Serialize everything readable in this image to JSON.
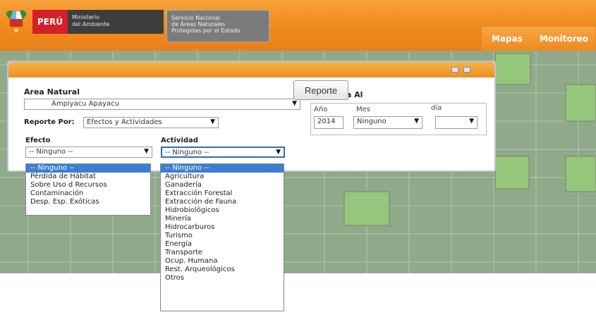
{
  "header": {
    "peru_label": "PERÚ",
    "ministerio_line1": "Ministerio",
    "ministerio_line2": "del Ambiente",
    "sernanp_line1": "Servicio Nacional",
    "sernanp_line2": "de Áreas Naturales",
    "sernanp_line3": "Protegidas por el Estado",
    "nav": [
      "Mapas",
      "Monitoreo"
    ]
  },
  "panel": {
    "area_label": "Area Natural",
    "area_value": "Ampiyacu Apayacu",
    "reporte_por_label": "Reporte Por:",
    "reporte_por_value": "Efectos y Actividades",
    "efecto_label": "Efecto",
    "efecto_value": "-- Ninguno --",
    "actividad_label": "Actividad",
    "actividad_value": "-- Ninguno --",
    "fecha_label": "Fecha Al",
    "anio_label": "Año",
    "mes_label": "Mes",
    "dia_label": "día",
    "anio_value": "2014",
    "mes_value": "Ninguno",
    "dia_value": "",
    "reporte_button": "Reporte"
  },
  "efecto_options": [
    "-- Ninguno --",
    "Pérdida de Hábitat",
    "Sobre Uso d Recursos",
    "Contaminación",
    "Desp. Esp. Exóticas"
  ],
  "actividad_options": [
    "-- Ninguno --",
    "Agricultura",
    "Ganadería",
    "Extracción Forestal",
    "Extracción de Fauna",
    "Hidrobiológicos",
    "Minería",
    "Hidrocarburos",
    "Turismo",
    "Energía",
    "Transporte",
    "Ocup. Humana",
    "Rest. Arqueológicos",
    "Otros"
  ],
  "colors": {
    "header_orange": "#f08a1c",
    "map_base": "#8fa98a",
    "map_cell": "#96c57c",
    "selection_blue": "#3b7fd1"
  }
}
